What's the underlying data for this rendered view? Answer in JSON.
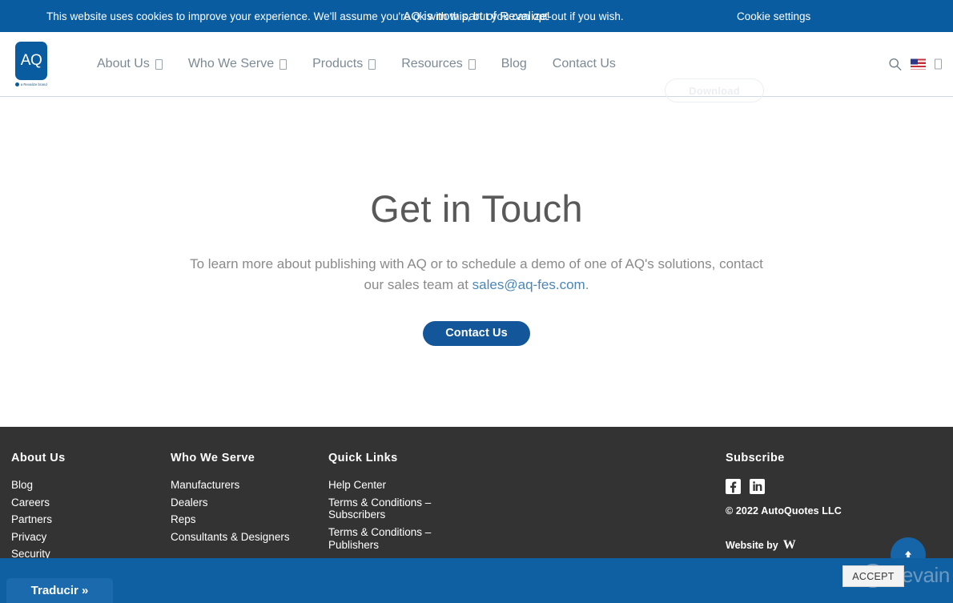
{
  "announcement": {
    "text": "AQ is now part of Revalize!"
  },
  "brand": {
    "logo_text": "AQ",
    "logo_tagline": "a Revalize brand",
    "icon": "aq-logo-icon"
  },
  "nav": {
    "items": [
      {
        "label": "About Us",
        "has_dropdown": true
      },
      {
        "label": "Who We Serve",
        "has_dropdown": true
      },
      {
        "label": "Products",
        "has_dropdown": true
      },
      {
        "label": "Resources",
        "has_dropdown": true
      },
      {
        "label": "Blog",
        "has_dropdown": false
      },
      {
        "label": "Contact Us",
        "has_dropdown": false
      }
    ],
    "download_label": "Download",
    "search_icon": "search-icon",
    "language_flag": "us-flag-icon",
    "language_dropdown": "chevron-down-icon"
  },
  "main": {
    "title": "Get in Touch",
    "lede_part1": "To learn more about publishing with AQ or to schedule a demo of one of AQ's solutions, contact our sales team at ",
    "lede_email": "sales@aq-fes.com",
    "lede_part2": ".",
    "cta_label": "Contact Us"
  },
  "footer": {
    "columns": [
      {
        "heading": "About Us",
        "links": [
          "Blog",
          "Careers",
          "Partners",
          "Privacy",
          "Security"
        ]
      },
      {
        "heading": "Who We Serve",
        "links": [
          "Manufacturers",
          "Dealers",
          "Reps",
          "Consultants & Designers"
        ]
      },
      {
        "heading": "Quick Links",
        "links": [
          "Help Center",
          "Terms & Conditions – Subscribers",
          "Terms & Conditions – Publishers"
        ]
      }
    ],
    "subscribe": {
      "heading": "Subscribe",
      "social": [
        {
          "name": "facebook-icon",
          "label": "f"
        },
        {
          "name": "linkedin-icon",
          "label": "in"
        }
      ],
      "copyright": "© 2022 AutoQuotes LLC",
      "website_by_label": "Website by",
      "website_by_mark": "W"
    }
  },
  "cookie_banner": {
    "text": "This website uses cookies to improve your experience. We'll assume you're ok with this, but you can opt-out if you wish.",
    "settings_label": "Cookie settings",
    "accept_label": "ACCEPT"
  },
  "translate_widget": {
    "label": "Traducir »"
  },
  "watermark": {
    "text": "Revain"
  },
  "scroll_top": {
    "icon": "arrow-up-icon"
  },
  "colors": {
    "announce_blue": "#0a5ca0",
    "cookie_blue": "#0f5fa3",
    "footer_dark": "#333333",
    "cta_blue": "#14569a",
    "link_blue": "#4a87b8",
    "nav_grey": "#7b8a95"
  }
}
